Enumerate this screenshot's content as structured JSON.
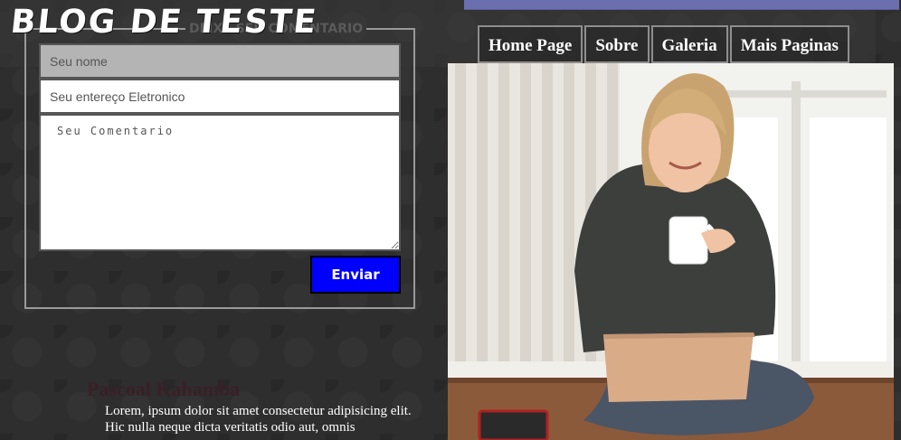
{
  "header": {
    "brand": "BLOG DE TESTE",
    "nav": [
      "Home Page",
      "Sobre",
      "Galeria",
      "Mais Paginas"
    ]
  },
  "comment_form": {
    "legend": "DEIXE SEU COMENTARIO",
    "name_placeholder": "Seu nome",
    "email_placeholder": "Seu entereço Eletronico",
    "comment_placeholder": "Seu Comentario",
    "submit_label": "Enviar"
  },
  "post": {
    "author": "Pascoal Kahamba",
    "text": "Lorem, ipsum dolor sit amet consectetur adipisicing elit. Hic nulla neque dicta veritatis odio aut, omnis"
  },
  "colors": {
    "accent_button": "#0000ff",
    "nav_strip": "#6b6fae",
    "background": "#2e2e2e"
  },
  "hero_image": {
    "icon": "photo-woman-laptop-coffee"
  }
}
